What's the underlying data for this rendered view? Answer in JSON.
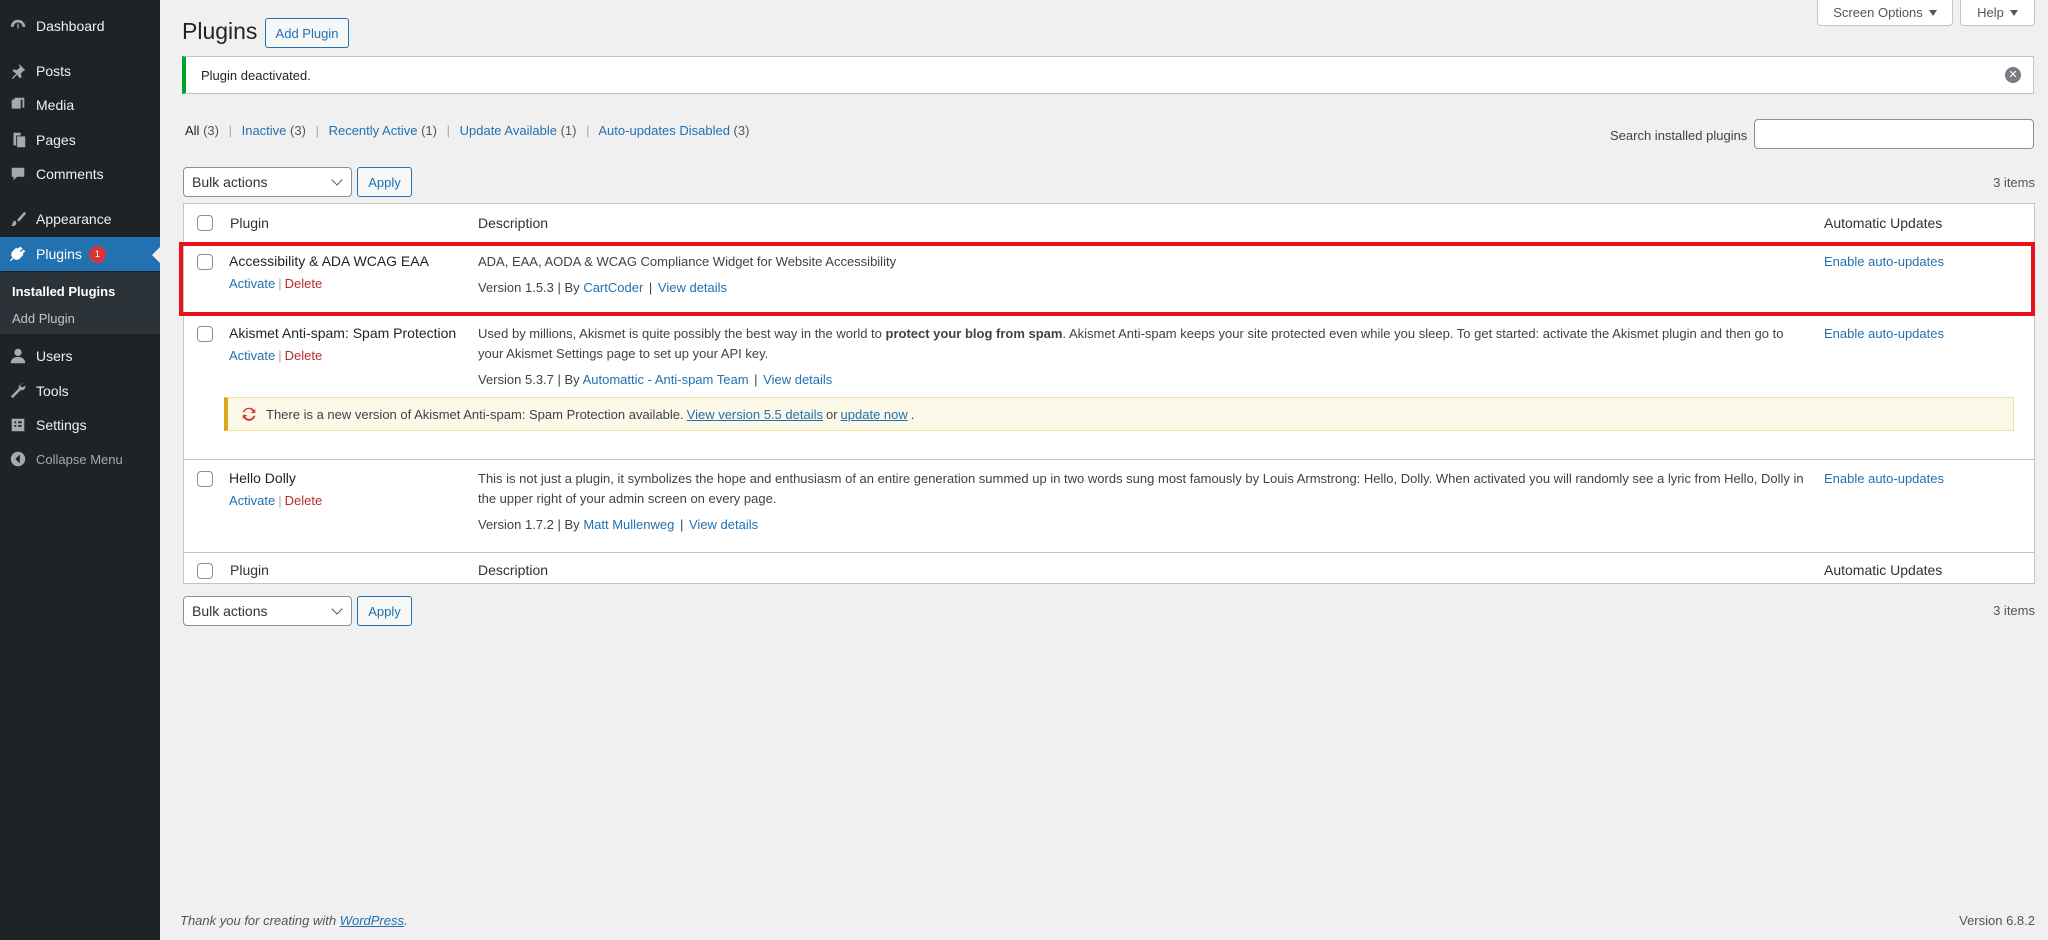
{
  "sidebar": {
    "dashboard": "Dashboard",
    "posts": "Posts",
    "media": "Media",
    "pages": "Pages",
    "comments": "Comments",
    "appearance": "Appearance",
    "plugins": "Plugins",
    "plugins_badge": "1",
    "installed_plugins": "Installed Plugins",
    "add_plugin": "Add Plugin",
    "users": "Users",
    "tools": "Tools",
    "settings": "Settings",
    "collapse": "Collapse Menu"
  },
  "top_tabs": {
    "screen_options": "Screen Options",
    "help": "Help"
  },
  "header": {
    "title": "Plugins",
    "add_plugin_button": "Add Plugin"
  },
  "notice": {
    "text": "Plugin deactivated."
  },
  "filters": {
    "all": "All",
    "all_count": "(3)",
    "inactive": "Inactive",
    "inactive_count": "(3)",
    "recently_active": "Recently Active",
    "recently_active_count": "(1)",
    "update_available": "Update Available",
    "update_available_count": "(1)",
    "autoupdates_disabled": "Auto-updates Disabled",
    "autoupdates_disabled_count": "(3)"
  },
  "search": {
    "label": "Search installed plugins",
    "value": ""
  },
  "bulk": {
    "label": "Bulk actions",
    "apply": "Apply",
    "items_count": "3 items"
  },
  "table": {
    "col_plugin": "Plugin",
    "col_description": "Description",
    "col_auto": "Automatic Updates",
    "activate": "Activate",
    "delete": "Delete",
    "version_by": "| By",
    "view_details": "View details",
    "enable_auto": "Enable auto-updates",
    "rows": [
      {
        "name": "Accessibility & ADA WCAG EAA",
        "description": "ADA, EAA, AODA & WCAG Compliance Widget for Website Accessibility",
        "version": "Version 1.5.3",
        "author": "CartCoder"
      },
      {
        "name": "Akismet Anti-spam: Spam Protection",
        "description_before": "Used by millions, Akismet is quite possibly the best way in the world to ",
        "description_bold": "protect your blog from spam",
        "description_after": ". Akismet Anti-spam keeps your site protected even while you sleep. To get started: activate the Akismet plugin and then go to your Akismet Settings page to set up your API key.",
        "version": "Version 5.3.7",
        "author": "Automattic - Anti-spam Team",
        "update_text": "There is a new version of Akismet Anti-spam: Spam Protection available.",
        "update_link": "View version 5.5 details",
        "update_or": "or",
        "update_now": "update now",
        "update_period": "."
      },
      {
        "name": "Hello Dolly",
        "description": "This is not just a plugin, it symbolizes the hope and enthusiasm of an entire generation summed up in two words sung most famously by Louis Armstrong: Hello, Dolly. When activated you will randomly see a lyric from Hello, Dolly in the upper right of your admin screen on every page.",
        "version": "Version 1.7.2",
        "author": "Matt Mullenweg"
      }
    ]
  },
  "footer": {
    "thanks": "Thank you for creating with",
    "wordpress": "WordPress",
    "period": ".",
    "version": "Version 6.8.2"
  },
  "colors": {
    "accent": "#2271b1",
    "sidebar": "#1d2327",
    "highlight": "#e8131a",
    "success": "#00a32a"
  }
}
